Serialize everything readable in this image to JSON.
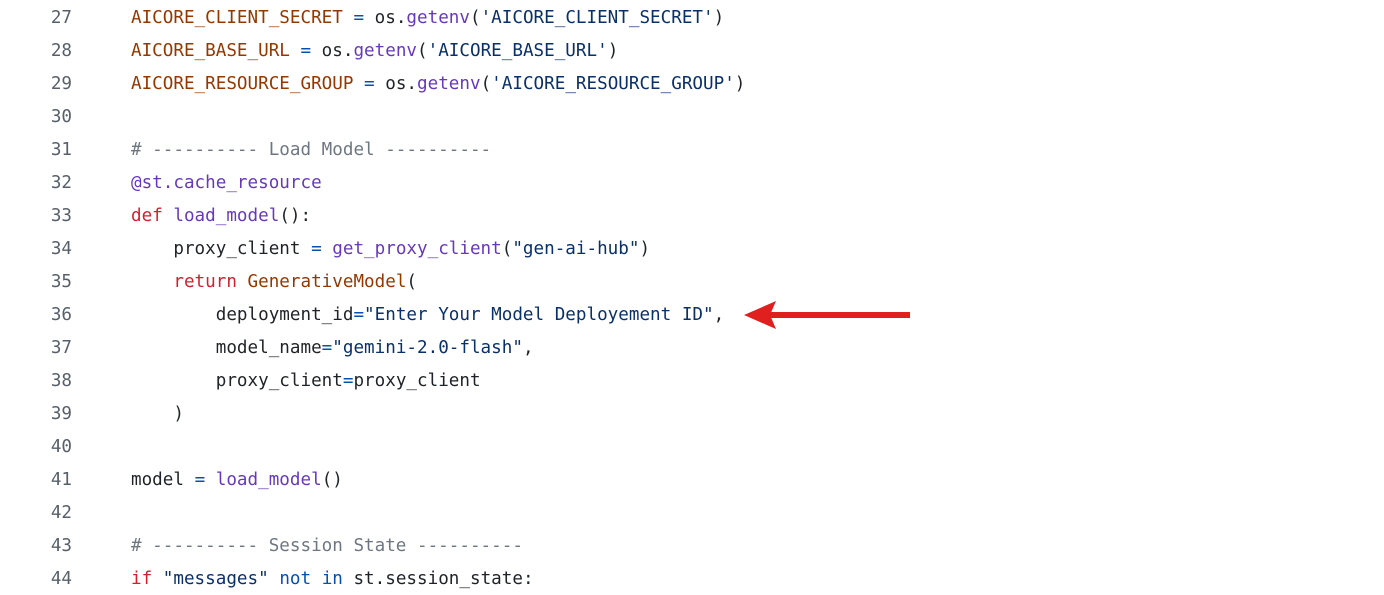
{
  "code_view": {
    "lines": [
      {
        "number": "27",
        "tokens": [
          {
            "text": "AICORE_CLIENT_SECRET",
            "kind": "const"
          },
          {
            "text": " ",
            "kind": "plain"
          },
          {
            "text": "=",
            "kind": "op"
          },
          {
            "text": " os.",
            "kind": "plain"
          },
          {
            "text": "getenv",
            "kind": "func"
          },
          {
            "text": "(",
            "kind": "plain"
          },
          {
            "text": "'AICORE_CLIENT_SECRET'",
            "kind": "str"
          },
          {
            "text": ")",
            "kind": "plain"
          }
        ]
      },
      {
        "number": "28",
        "tokens": [
          {
            "text": "AICORE_BASE_URL",
            "kind": "const"
          },
          {
            "text": " ",
            "kind": "plain"
          },
          {
            "text": "=",
            "kind": "op"
          },
          {
            "text": " os.",
            "kind": "plain"
          },
          {
            "text": "getenv",
            "kind": "func"
          },
          {
            "text": "(",
            "kind": "plain"
          },
          {
            "text": "'AICORE_BASE_URL'",
            "kind": "str"
          },
          {
            "text": ")",
            "kind": "plain"
          }
        ]
      },
      {
        "number": "29",
        "tokens": [
          {
            "text": "AICORE_RESOURCE_GROUP",
            "kind": "const"
          },
          {
            "text": " ",
            "kind": "plain"
          },
          {
            "text": "=",
            "kind": "op"
          },
          {
            "text": " os.",
            "kind": "plain"
          },
          {
            "text": "getenv",
            "kind": "func"
          },
          {
            "text": "(",
            "kind": "plain"
          },
          {
            "text": "'AICORE_RESOURCE_GROUP'",
            "kind": "str"
          },
          {
            "text": ")",
            "kind": "plain"
          }
        ]
      },
      {
        "number": "30",
        "tokens": []
      },
      {
        "number": "31",
        "tokens": [
          {
            "text": "# ---------- Load Model ----------",
            "kind": "comment"
          }
        ]
      },
      {
        "number": "32",
        "tokens": [
          {
            "text": "@st.cache_resource",
            "kind": "func"
          }
        ]
      },
      {
        "number": "33",
        "tokens": [
          {
            "text": "def",
            "kind": "keyword"
          },
          {
            "text": " ",
            "kind": "plain"
          },
          {
            "text": "load_model",
            "kind": "func"
          },
          {
            "text": "():",
            "kind": "plain"
          }
        ]
      },
      {
        "number": "34",
        "tokens": [
          {
            "text": "    proxy_client ",
            "kind": "plain"
          },
          {
            "text": "=",
            "kind": "op"
          },
          {
            "text": " ",
            "kind": "plain"
          },
          {
            "text": "get_proxy_client",
            "kind": "func"
          },
          {
            "text": "(",
            "kind": "plain"
          },
          {
            "text": "\"gen-ai-hub\"",
            "kind": "str"
          },
          {
            "text": ")",
            "kind": "plain"
          }
        ]
      },
      {
        "number": "35",
        "tokens": [
          {
            "text": "    ",
            "kind": "plain"
          },
          {
            "text": "return",
            "kind": "keyword"
          },
          {
            "text": " ",
            "kind": "plain"
          },
          {
            "text": "GenerativeModel",
            "kind": "class"
          },
          {
            "text": "(",
            "kind": "plain"
          }
        ]
      },
      {
        "number": "36",
        "tokens": [
          {
            "text": "        deployment_id",
            "kind": "plain"
          },
          {
            "text": "=",
            "kind": "op"
          },
          {
            "text": "\"Enter Your Model Deployement ID\"",
            "kind": "str"
          },
          {
            "text": ",",
            "kind": "plain"
          }
        ]
      },
      {
        "number": "37",
        "tokens": [
          {
            "text": "        model_name",
            "kind": "plain"
          },
          {
            "text": "=",
            "kind": "op"
          },
          {
            "text": "\"gemini-2.0-flash\"",
            "kind": "str"
          },
          {
            "text": ",",
            "kind": "plain"
          }
        ]
      },
      {
        "number": "38",
        "tokens": [
          {
            "text": "        proxy_client",
            "kind": "plain"
          },
          {
            "text": "=",
            "kind": "op"
          },
          {
            "text": "proxy_client",
            "kind": "plain"
          }
        ]
      },
      {
        "number": "39",
        "tokens": [
          {
            "text": "    )",
            "kind": "plain"
          }
        ]
      },
      {
        "number": "40",
        "tokens": []
      },
      {
        "number": "41",
        "tokens": [
          {
            "text": "model ",
            "kind": "plain"
          },
          {
            "text": "=",
            "kind": "op"
          },
          {
            "text": " ",
            "kind": "plain"
          },
          {
            "text": "load_model",
            "kind": "func"
          },
          {
            "text": "()",
            "kind": "plain"
          }
        ]
      },
      {
        "number": "42",
        "tokens": []
      },
      {
        "number": "43",
        "tokens": [
          {
            "text": "# ---------- Session State ----------",
            "kind": "comment"
          }
        ]
      },
      {
        "number": "44",
        "tokens": [
          {
            "text": "if",
            "kind": "keyword"
          },
          {
            "text": " ",
            "kind": "plain"
          },
          {
            "text": "\"messages\"",
            "kind": "str"
          },
          {
            "text": " ",
            "kind": "plain"
          },
          {
            "text": "not",
            "kind": "op"
          },
          {
            "text": " ",
            "kind": "plain"
          },
          {
            "text": "in",
            "kind": "op"
          },
          {
            "text": " st.session_state:",
            "kind": "plain"
          }
        ]
      }
    ]
  },
  "annotation": {
    "arrow_color": "#e0201f",
    "points_to_line": "36"
  }
}
